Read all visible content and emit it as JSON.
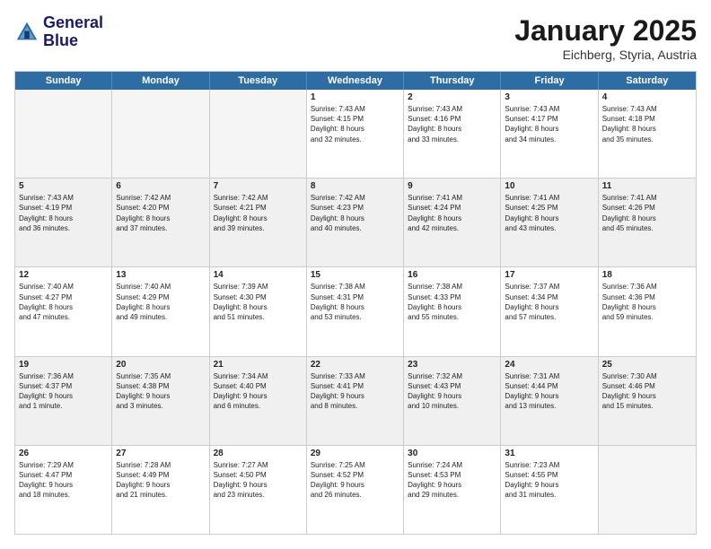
{
  "header": {
    "logo_line1": "General",
    "logo_line2": "Blue",
    "title": "January 2025",
    "subtitle": "Eichberg, Styria, Austria"
  },
  "days": [
    "Sunday",
    "Monday",
    "Tuesday",
    "Wednesday",
    "Thursday",
    "Friday",
    "Saturday"
  ],
  "rows": [
    [
      {
        "day": "",
        "empty": true
      },
      {
        "day": "",
        "empty": true
      },
      {
        "day": "",
        "empty": true
      },
      {
        "day": "1",
        "text": "Sunrise: 7:43 AM\nSunset: 4:15 PM\nDaylight: 8 hours\nand 32 minutes."
      },
      {
        "day": "2",
        "text": "Sunrise: 7:43 AM\nSunset: 4:16 PM\nDaylight: 8 hours\nand 33 minutes."
      },
      {
        "day": "3",
        "text": "Sunrise: 7:43 AM\nSunset: 4:17 PM\nDaylight: 8 hours\nand 34 minutes."
      },
      {
        "day": "4",
        "text": "Sunrise: 7:43 AM\nSunset: 4:18 PM\nDaylight: 8 hours\nand 35 minutes."
      }
    ],
    [
      {
        "day": "5",
        "text": "Sunrise: 7:43 AM\nSunset: 4:19 PM\nDaylight: 8 hours\nand 36 minutes."
      },
      {
        "day": "6",
        "text": "Sunrise: 7:42 AM\nSunset: 4:20 PM\nDaylight: 8 hours\nand 37 minutes."
      },
      {
        "day": "7",
        "text": "Sunrise: 7:42 AM\nSunset: 4:21 PM\nDaylight: 8 hours\nand 39 minutes."
      },
      {
        "day": "8",
        "text": "Sunrise: 7:42 AM\nSunset: 4:23 PM\nDaylight: 8 hours\nand 40 minutes."
      },
      {
        "day": "9",
        "text": "Sunrise: 7:41 AM\nSunset: 4:24 PM\nDaylight: 8 hours\nand 42 minutes."
      },
      {
        "day": "10",
        "text": "Sunrise: 7:41 AM\nSunset: 4:25 PM\nDaylight: 8 hours\nand 43 minutes."
      },
      {
        "day": "11",
        "text": "Sunrise: 7:41 AM\nSunset: 4:26 PM\nDaylight: 8 hours\nand 45 minutes."
      }
    ],
    [
      {
        "day": "12",
        "text": "Sunrise: 7:40 AM\nSunset: 4:27 PM\nDaylight: 8 hours\nand 47 minutes."
      },
      {
        "day": "13",
        "text": "Sunrise: 7:40 AM\nSunset: 4:29 PM\nDaylight: 8 hours\nand 49 minutes."
      },
      {
        "day": "14",
        "text": "Sunrise: 7:39 AM\nSunset: 4:30 PM\nDaylight: 8 hours\nand 51 minutes."
      },
      {
        "day": "15",
        "text": "Sunrise: 7:38 AM\nSunset: 4:31 PM\nDaylight: 8 hours\nand 53 minutes."
      },
      {
        "day": "16",
        "text": "Sunrise: 7:38 AM\nSunset: 4:33 PM\nDaylight: 8 hours\nand 55 minutes."
      },
      {
        "day": "17",
        "text": "Sunrise: 7:37 AM\nSunset: 4:34 PM\nDaylight: 8 hours\nand 57 minutes."
      },
      {
        "day": "18",
        "text": "Sunrise: 7:36 AM\nSunset: 4:36 PM\nDaylight: 8 hours\nand 59 minutes."
      }
    ],
    [
      {
        "day": "19",
        "text": "Sunrise: 7:36 AM\nSunset: 4:37 PM\nDaylight: 9 hours\nand 1 minute."
      },
      {
        "day": "20",
        "text": "Sunrise: 7:35 AM\nSunset: 4:38 PM\nDaylight: 9 hours\nand 3 minutes."
      },
      {
        "day": "21",
        "text": "Sunrise: 7:34 AM\nSunset: 4:40 PM\nDaylight: 9 hours\nand 6 minutes."
      },
      {
        "day": "22",
        "text": "Sunrise: 7:33 AM\nSunset: 4:41 PM\nDaylight: 9 hours\nand 8 minutes."
      },
      {
        "day": "23",
        "text": "Sunrise: 7:32 AM\nSunset: 4:43 PM\nDaylight: 9 hours\nand 10 minutes."
      },
      {
        "day": "24",
        "text": "Sunrise: 7:31 AM\nSunset: 4:44 PM\nDaylight: 9 hours\nand 13 minutes."
      },
      {
        "day": "25",
        "text": "Sunrise: 7:30 AM\nSunset: 4:46 PM\nDaylight: 9 hours\nand 15 minutes."
      }
    ],
    [
      {
        "day": "26",
        "text": "Sunrise: 7:29 AM\nSunset: 4:47 PM\nDaylight: 9 hours\nand 18 minutes."
      },
      {
        "day": "27",
        "text": "Sunrise: 7:28 AM\nSunset: 4:49 PM\nDaylight: 9 hours\nand 21 minutes."
      },
      {
        "day": "28",
        "text": "Sunrise: 7:27 AM\nSunset: 4:50 PM\nDaylight: 9 hours\nand 23 minutes."
      },
      {
        "day": "29",
        "text": "Sunrise: 7:25 AM\nSunset: 4:52 PM\nDaylight: 9 hours\nand 26 minutes."
      },
      {
        "day": "30",
        "text": "Sunrise: 7:24 AM\nSunset: 4:53 PM\nDaylight: 9 hours\nand 29 minutes."
      },
      {
        "day": "31",
        "text": "Sunrise: 7:23 AM\nSunset: 4:55 PM\nDaylight: 9 hours\nand 31 minutes."
      },
      {
        "day": "",
        "empty": true
      }
    ]
  ]
}
